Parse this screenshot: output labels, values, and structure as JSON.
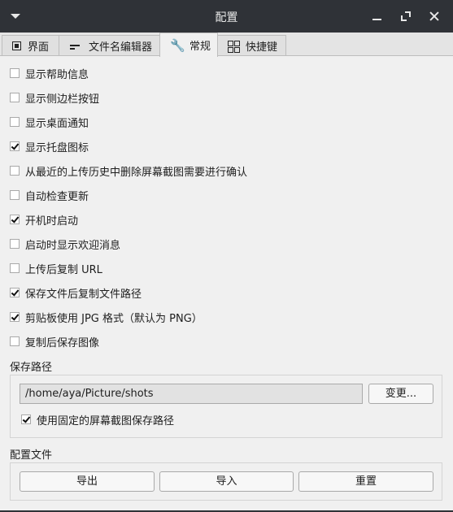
{
  "window": {
    "title": "配置"
  },
  "tabs": [
    {
      "label": "界面",
      "icon": "interface-icon"
    },
    {
      "label": "文件名编辑器",
      "icon": "lines-icon"
    },
    {
      "label": "常规",
      "icon": "wrench-icon",
      "active": true
    },
    {
      "label": "快捷键",
      "icon": "grid-icon"
    }
  ],
  "options": [
    {
      "label": "显示帮助信息",
      "checked": false
    },
    {
      "label": "显示侧边栏按钮",
      "checked": false
    },
    {
      "label": "显示桌面通知",
      "checked": false
    },
    {
      "label": "显示托盘图标",
      "checked": true
    },
    {
      "label": "从最近的上传历史中删除屏幕截图需要进行确认",
      "checked": false
    },
    {
      "label": "自动检查更新",
      "checked": false
    },
    {
      "label": "开机时启动",
      "checked": true
    },
    {
      "label": "启动时显示欢迎消息",
      "checked": false
    },
    {
      "label": "上传后复制 URL",
      "checked": false
    },
    {
      "label": "保存文件后复制文件路径",
      "checked": true
    },
    {
      "label": "剪贴板使用 JPG 格式（默认为 PNG）",
      "checked": true
    },
    {
      "label": "复制后保存图像",
      "checked": false
    }
  ],
  "save_path": {
    "label": "保存路径",
    "value": "/home/aya/Picture/shots",
    "change_button": "变更...",
    "fixed_path": {
      "label": "使用固定的屏幕截图保存路径",
      "checked": true
    }
  },
  "config_file": {
    "label": "配置文件",
    "export_button": "导出",
    "import_button": "导入",
    "reset_button": "重置"
  }
}
